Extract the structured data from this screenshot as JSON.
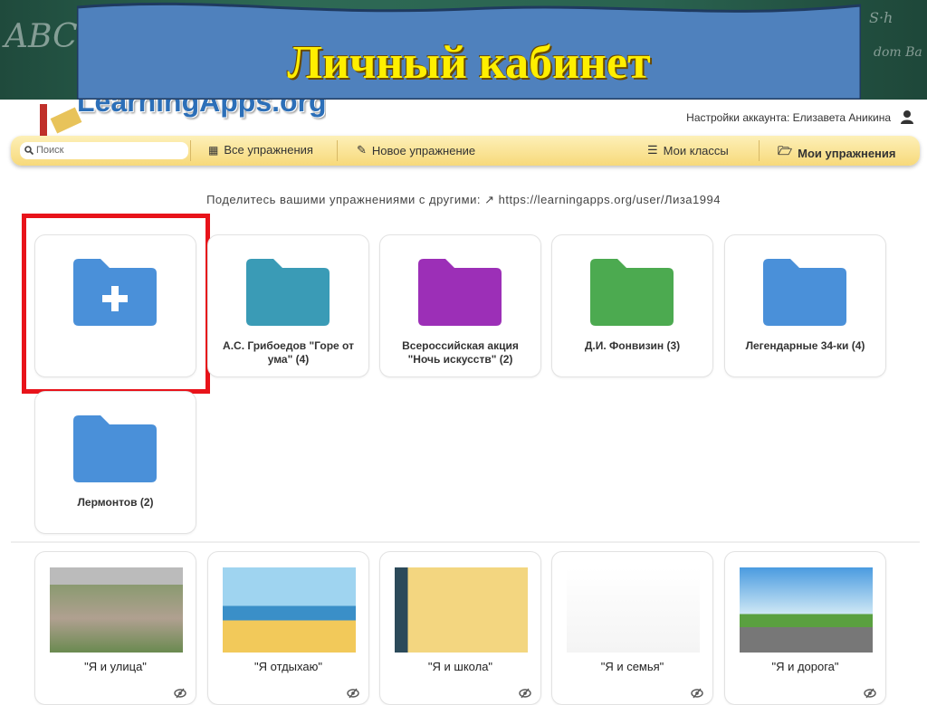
{
  "slide_title": "Личный кабинет",
  "logo_text": "LearningApps.org",
  "account": "Настройки аккаунта: Елизавета Аникина",
  "nav": {
    "search_placeholder": "Поиск",
    "all": "Все упражнения",
    "new": "Новое упражнение",
    "classes": "Мои классы",
    "mine": "Мои упражнения"
  },
  "share": {
    "label": "Поделитесь вашими упражнениями с другими:",
    "url": "https://learningapps.org/user/Лиза1994"
  },
  "folders": [
    {
      "label": "А.С. Грибоедов \"Горе от ума\" (4)",
      "color": "#3a9bb6"
    },
    {
      "label": "Всероссийская акция \"Ночь искусств\" (2)",
      "color": "#9c2fb7"
    },
    {
      "label": "Д.И. Фонвизин (3)",
      "color": "#4caa50"
    },
    {
      "label": "Легендарные 34-ки (4)",
      "color": "#4a90d9"
    },
    {
      "label": "Лермонтов (2)",
      "color": "#4a90d9"
    }
  ],
  "new_folder_color": "#4a90d9",
  "apps": [
    {
      "label": "\"Я и улица\""
    },
    {
      "label": "\"Я отдыхаю\""
    },
    {
      "label": "\"Я и школа\""
    },
    {
      "label": "\"Я и семья\""
    },
    {
      "label": "\"Я и дорога\""
    }
  ]
}
